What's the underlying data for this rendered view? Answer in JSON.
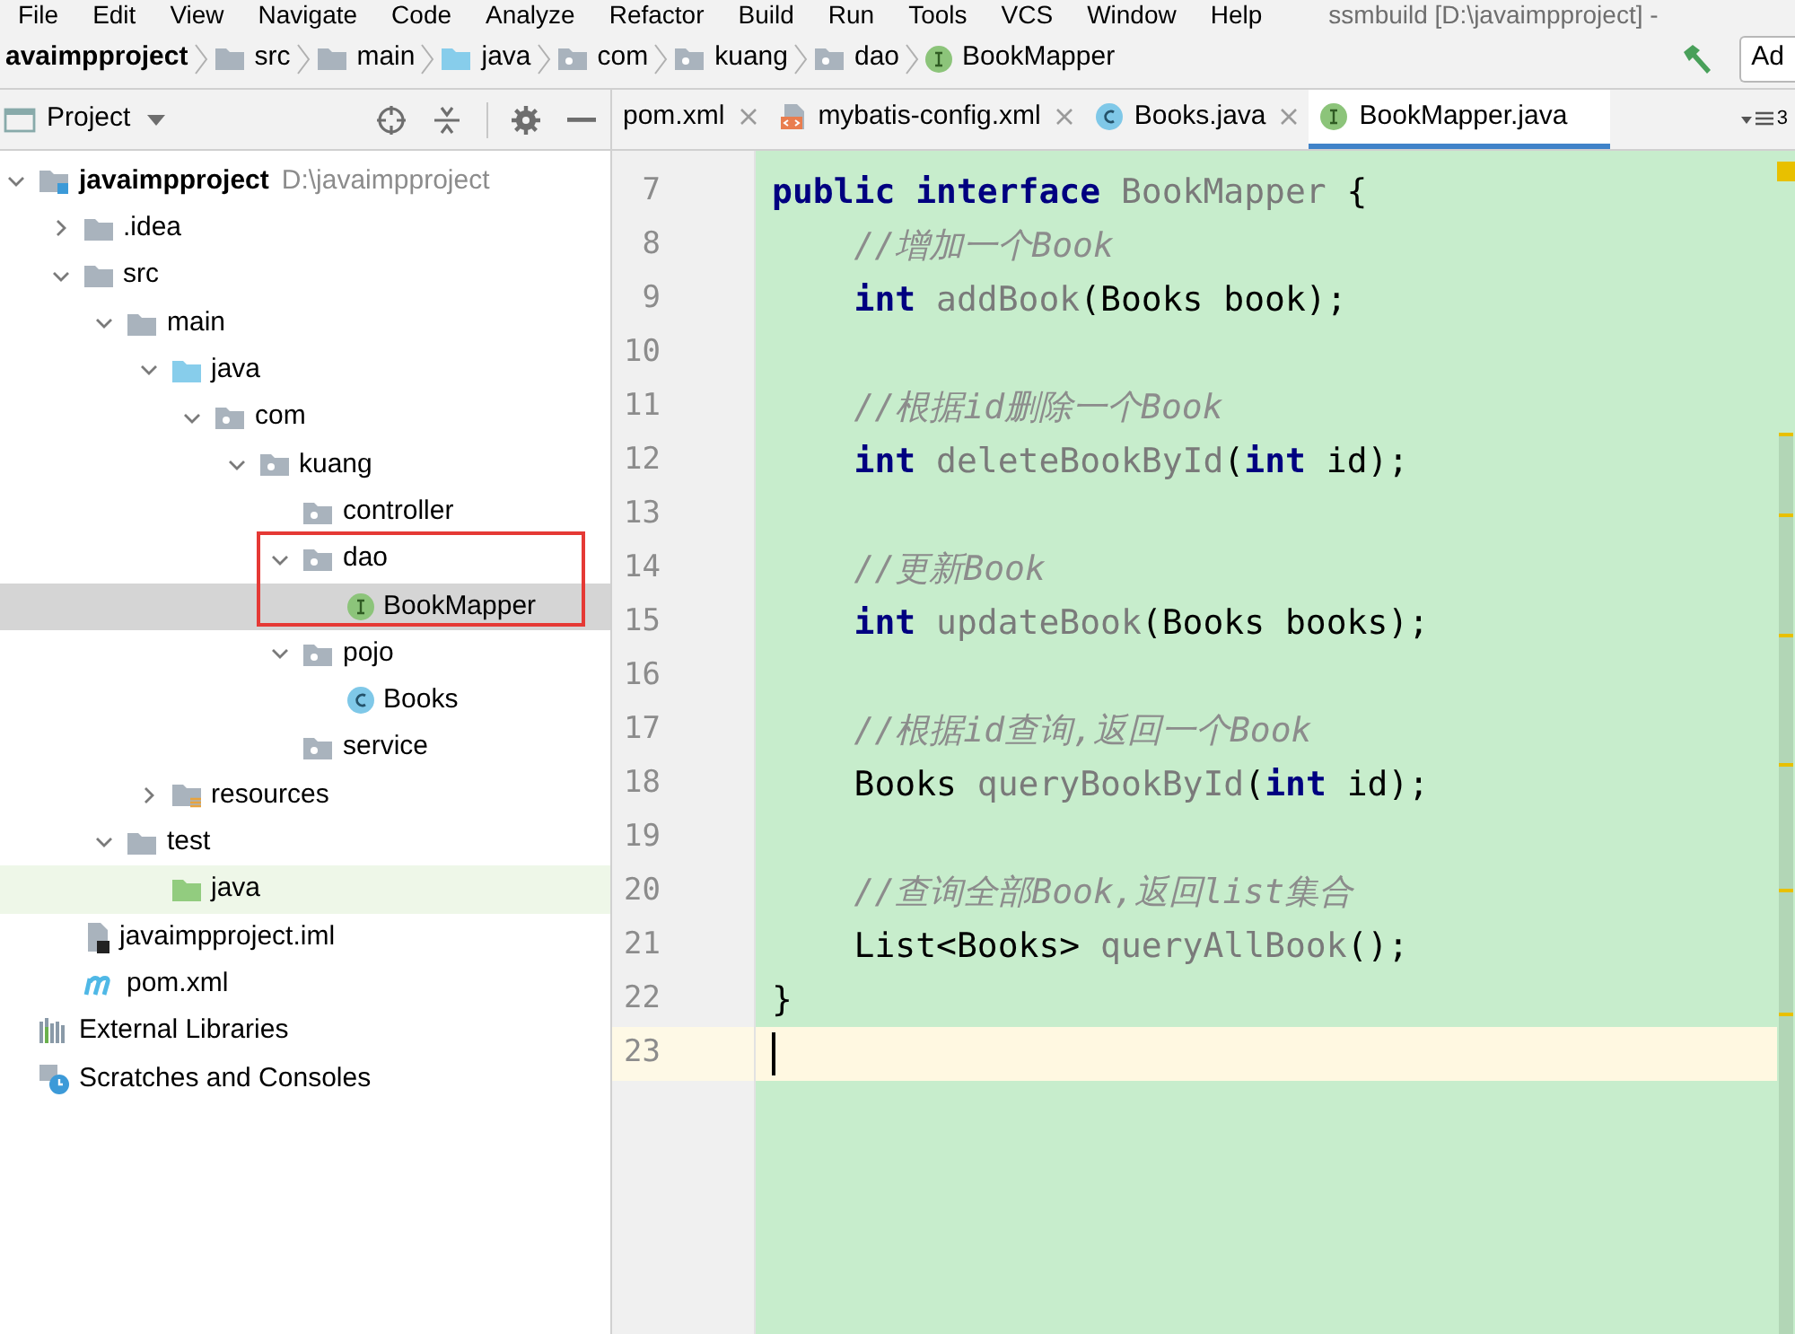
{
  "menu_bar": {
    "items": [
      "File",
      "Edit",
      "View",
      "Navigate",
      "Code",
      "Analyze",
      "Refactor",
      "Build",
      "Run",
      "Tools",
      "VCS",
      "Window",
      "Help"
    ],
    "title": "ssmbuild [D:\\javaimpproject] -"
  },
  "breadcrumbs": {
    "items": [
      {
        "label": "avaimpproject"
      },
      {
        "label": "src",
        "kind": "folder"
      },
      {
        "label": "main",
        "kind": "folder"
      },
      {
        "label": "java",
        "kind": "source-root"
      },
      {
        "label": "com",
        "kind": "package"
      },
      {
        "label": "kuang",
        "kind": "package"
      },
      {
        "label": "dao",
        "kind": "package"
      },
      {
        "label": "BookMapper",
        "kind": "interface"
      }
    ],
    "right_button": "Ad"
  },
  "project_panel": {
    "title": "Project",
    "tree": [
      {
        "label": "javaimpproject",
        "path": "D:\\javaimpproject",
        "kind": "module",
        "expanded": true,
        "selected": false,
        "children": [
          {
            "label": ".idea",
            "kind": "folder",
            "expanded": false,
            "selected": false
          },
          {
            "label": "src",
            "kind": "folder",
            "expanded": true,
            "selected": false,
            "children": [
              {
                "label": "main",
                "kind": "folder",
                "expanded": true,
                "selected": false,
                "children": [
                  {
                    "label": "java",
                    "kind": "source-root",
                    "expanded": true,
                    "selected": false,
                    "children": [
                      {
                        "label": "com",
                        "kind": "package",
                        "expanded": true,
                        "selected": false,
                        "children": [
                          {
                            "label": "kuang",
                            "kind": "package",
                            "expanded": true,
                            "selected": false,
                            "children": [
                              {
                                "label": "controller",
                                "kind": "package",
                                "selected": false
                              },
                              {
                                "label": "dao",
                                "kind": "package",
                                "expanded": true,
                                "selected": false,
                                "framed": true,
                                "children": [
                                  {
                                    "label": "BookMapper",
                                    "kind": "interface",
                                    "selected": true
                                  }
                                ]
                              },
                              {
                                "label": "pojo",
                                "kind": "package",
                                "expanded": true,
                                "selected": false,
                                "children": [
                                  {
                                    "label": "Books",
                                    "kind": "class",
                                    "selected": false
                                  }
                                ]
                              },
                              {
                                "label": "service",
                                "kind": "package",
                                "selected": false
                              }
                            ]
                          }
                        ]
                      }
                    ]
                  },
                  {
                    "label": "resources",
                    "kind": "resources-root",
                    "expanded": false,
                    "selected": false
                  }
                ]
              },
              {
                "label": "test",
                "kind": "folder",
                "expanded": true,
                "selected": false,
                "children": [
                  {
                    "label": "java",
                    "kind": "test-root",
                    "selected": false
                  }
                ]
              }
            ]
          },
          {
            "label": "javaimpproject.iml",
            "kind": "module-file",
            "selected": false
          },
          {
            "label": "pom.xml",
            "kind": "maven",
            "selected": false
          }
        ]
      },
      {
        "label": "External Libraries",
        "kind": "libraries",
        "selected": false
      },
      {
        "label": "Scratches and Consoles",
        "kind": "scratches",
        "selected": false
      }
    ]
  },
  "editor_tabs": {
    "tabs": [
      {
        "label": "pom.xml",
        "selected": false,
        "closable": true
      },
      {
        "label": "mybatis-config.xml",
        "kind": "xml",
        "selected": false,
        "closable": true
      },
      {
        "label": "Books.java",
        "kind": "class",
        "selected": false,
        "closable": true
      },
      {
        "label": "BookMapper.java",
        "kind": "interface",
        "selected": true,
        "closable": false
      }
    ],
    "overflow_count": "3"
  },
  "editor": {
    "lines": [
      {
        "number": "7",
        "current": false,
        "tokens": [
          {
            "kind": "keyword",
            "text": "public interface "
          },
          {
            "kind": "name",
            "text": "BookMapper"
          },
          {
            "kind": "plain",
            "text": " {"
          }
        ]
      },
      {
        "number": "8",
        "current": false,
        "tokens": [
          {
            "kind": "comment",
            "text": "    //增加一个Book"
          }
        ]
      },
      {
        "number": "9",
        "current": false,
        "tokens": [
          {
            "kind": "keyword",
            "text": "    int "
          },
          {
            "kind": "name",
            "text": "addBook"
          },
          {
            "kind": "plain",
            "text": "(Books book);"
          }
        ]
      },
      {
        "number": "10",
        "current": false
      },
      {
        "number": "11",
        "current": false,
        "tokens": [
          {
            "kind": "comment",
            "text": "    //根据id删除一个Book"
          }
        ]
      },
      {
        "number": "12",
        "current": false,
        "tokens": [
          {
            "kind": "keyword",
            "text": "    int "
          },
          {
            "kind": "name",
            "text": "deleteBookById"
          },
          {
            "kind": "plain",
            "text": "("
          },
          {
            "kind": "keyword",
            "text": "int"
          },
          {
            "kind": "plain",
            "text": " id);"
          }
        ]
      },
      {
        "number": "13",
        "current": false
      },
      {
        "number": "14",
        "current": false,
        "tokens": [
          {
            "kind": "comment",
            "text": "    //更新Book"
          }
        ]
      },
      {
        "number": "15",
        "current": false,
        "tokens": [
          {
            "kind": "keyword",
            "text": "    int "
          },
          {
            "kind": "name",
            "text": "updateBook"
          },
          {
            "kind": "plain",
            "text": "(Books books);"
          }
        ]
      },
      {
        "number": "16",
        "current": false
      },
      {
        "number": "17",
        "current": false,
        "tokens": [
          {
            "kind": "comment",
            "text": "    //根据id查询,返回一个Book"
          }
        ]
      },
      {
        "number": "18",
        "current": false,
        "tokens": [
          {
            "kind": "plain",
            "text": "    Books "
          },
          {
            "kind": "name",
            "text": "queryBookById"
          },
          {
            "kind": "plain",
            "text": "("
          },
          {
            "kind": "keyword",
            "text": "int"
          },
          {
            "kind": "plain",
            "text": " id);"
          }
        ]
      },
      {
        "number": "19",
        "current": false
      },
      {
        "number": "20",
        "current": false,
        "tokens": [
          {
            "kind": "comment",
            "text": "    //查询全部Book,返回list集合"
          }
        ]
      },
      {
        "number": "21",
        "current": false,
        "tokens": [
          {
            "kind": "plain",
            "text": "    List<Books> "
          },
          {
            "kind": "name",
            "text": "queryAllBook"
          },
          {
            "kind": "plain",
            "text": "();"
          }
        ]
      },
      {
        "number": "22",
        "current": false,
        "tokens": [
          {
            "kind": "plain",
            "text": "}"
          }
        ]
      },
      {
        "number": "23",
        "current": true
      }
    ]
  }
}
